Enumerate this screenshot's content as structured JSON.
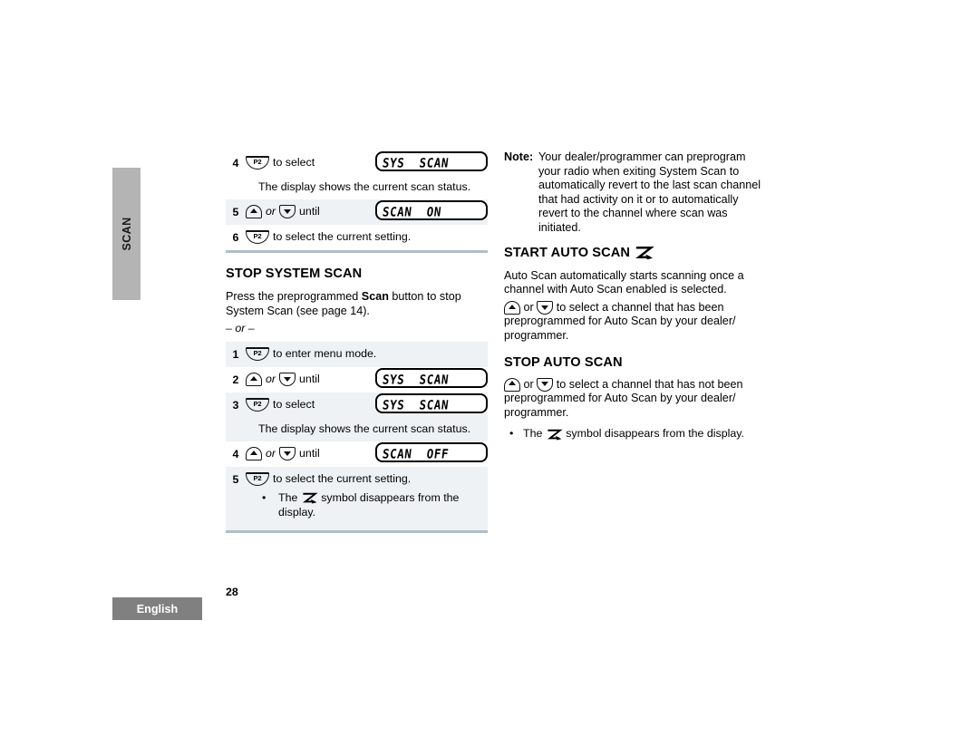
{
  "side_tab": {
    "label": "SCAN"
  },
  "left_column": {
    "table_top": {
      "rows": [
        {
          "num": "4",
          "button": "p2-button",
          "button_label": "P2",
          "text": "to select",
          "lcd": "SYS  SCAN",
          "shaded": false
        },
        {
          "note": "The display shows the current scan status.",
          "shaded": false
        },
        {
          "num": "5",
          "button": "up-down-buttons",
          "or_word": "or",
          "text": "until",
          "lcd": "SCAN  ON",
          "shaded": true
        },
        {
          "num": "6",
          "button": "p2-button",
          "button_label": "P2",
          "text": "to select the current setting.",
          "shaded": false
        }
      ]
    },
    "heading": "STOP SYSTEM SCAN",
    "paragraph_parts": {
      "before_bold": "Press the preprogrammed ",
      "bold": "Scan",
      "after_bold": " button to stop System Scan (see page 14)."
    },
    "or_separator": "– or –",
    "table_bottom": {
      "rows": [
        {
          "num": "1",
          "button": "p2-button",
          "button_label": "P2",
          "text": "to enter menu mode.",
          "shaded": true
        },
        {
          "num": "2",
          "button": "up-down-buttons",
          "or_word": "or",
          "text": "until",
          "lcd": "SYS  SCAN",
          "shaded": false
        },
        {
          "num": "3",
          "button": "p2-button",
          "button_label": "P2",
          "text": "to select",
          "lcd": "SYS  SCAN",
          "shaded": true
        },
        {
          "note": "The display shows the current scan status.",
          "shaded": true
        },
        {
          "num": "4",
          "button": "up-down-buttons",
          "or_word": "or",
          "text": "until",
          "lcd": "SCAN  OFF",
          "shaded": false
        },
        {
          "num": "5",
          "button": "p2-button",
          "button_label": "P2",
          "text": "to select the current setting.",
          "shaded": true,
          "sub_bullet_before": "The ",
          "sub_bullet_after": " symbol disappears from the display."
        }
      ]
    }
  },
  "right_column": {
    "note": {
      "label": "Note:",
      "text": "Your dealer/programmer can preprogram your radio when exiting System Scan to automatically revert to the last scan channel that had activity on it or to automatically revert to the channel where scan was initiated."
    },
    "heading_start": "START AUTO SCAN",
    "paragraph_1": "Auto Scan automatically starts scanning once a channel with Auto Scan enabled is selected.",
    "paragraph_2_or": "or",
    "paragraph_2_text": "to select a channel that has been preprogrammed for Auto Scan by your dealer/ programmer.",
    "heading_stop": "STOP AUTO SCAN",
    "paragraph_3_or": "or",
    "paragraph_3_text": "to select a channel that has not been preprogrammed for Auto Scan by your dealer/ programmer.",
    "bullet_before": "The ",
    "bullet_after": " symbol disappears from the display."
  },
  "footer": {
    "language_tab": "English",
    "page_number": "28"
  },
  "colors": {
    "side_tab": "#b4b4b4",
    "language_tab": "#808080",
    "rule": "#aebfc7",
    "shaded_row": "#eef2f5"
  }
}
